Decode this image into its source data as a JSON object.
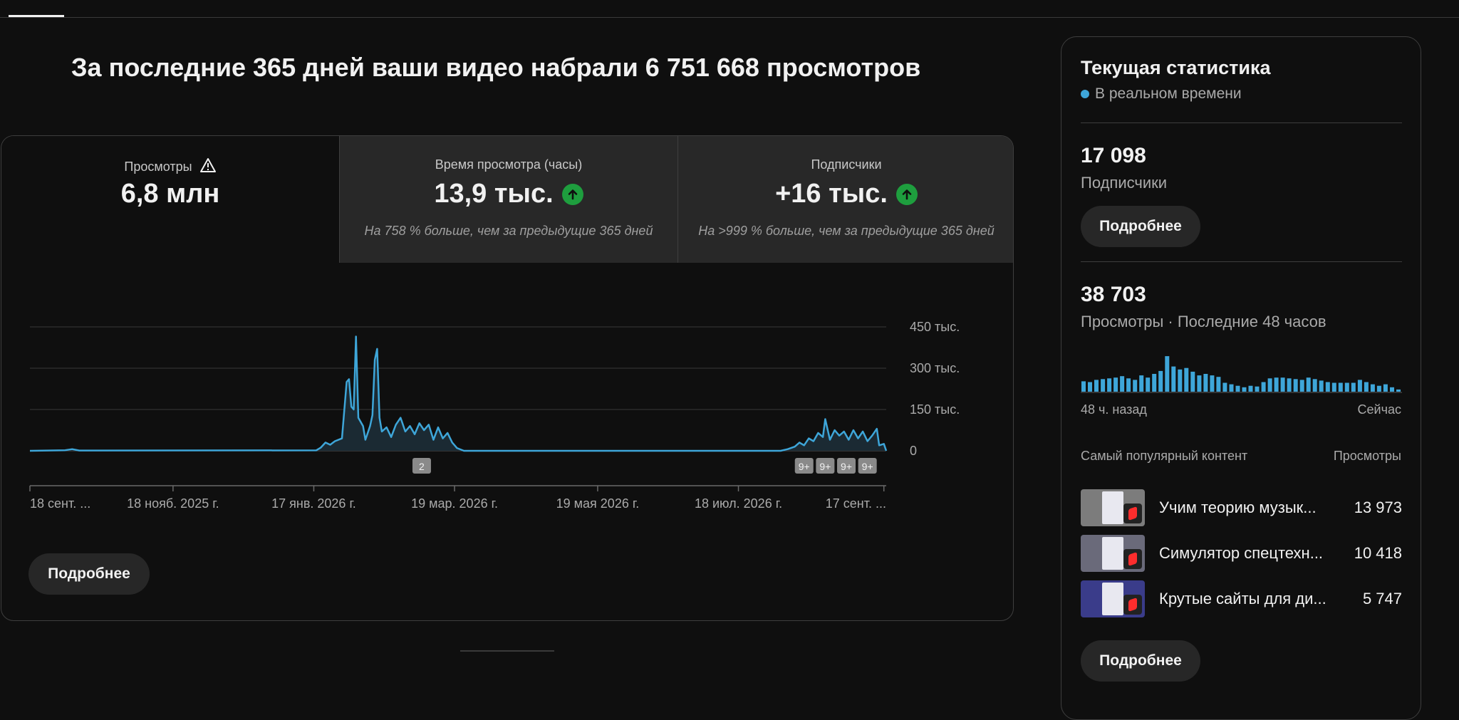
{
  "headline": "За последние 365 дней ваши видео набрали 6 751 668 просмотров",
  "metrics": [
    {
      "label": "Просмотры",
      "value": "6,8 млн",
      "icon": "warning-icon"
    },
    {
      "label": "Время просмотра (часы)",
      "value": "13,9 тыс.",
      "delta": "На 758 % больше, чем за предыдущие 365 дней",
      "icon": "arrow-up-icon"
    },
    {
      "label": "Подписчики",
      "value": "+16 тыс.",
      "delta": "На >999 % больше, чем за предыдущие 365 дней",
      "icon": "arrow-up-icon"
    }
  ],
  "main_more_label": "Подробнее",
  "chart_data": {
    "type": "line",
    "y_ticks": [
      "450 тыс.",
      "300 тыс.",
      "150 тыс.",
      "0"
    ],
    "x_ticks": [
      "18 сент. ...",
      "18 нояб. 2025 г.",
      "17 янв. 2026 г.",
      "19 мар. 2026 г.",
      "19 мая 2026 г.",
      "18 июл. 2026 г.",
      "17 сент. ..."
    ],
    "ylim": [
      0,
      450000
    ],
    "grid": true,
    "markers": [
      "2",
      "9+",
      "9+",
      "9+",
      "9+"
    ],
    "series": [
      {
        "values": [
          {
            "day": 0,
            "v": 0
          },
          {
            "day": 15,
            "v": 2000
          },
          {
            "day": 18,
            "v": 6000
          },
          {
            "day": 21,
            "v": 1000
          },
          {
            "day": 122,
            "v": 1500
          },
          {
            "day": 124,
            "v": 12000
          },
          {
            "day": 126,
            "v": 30000
          },
          {
            "day": 128,
            "v": 22000
          },
          {
            "day": 130,
            "v": 35000
          },
          {
            "day": 133,
            "v": 45000
          },
          {
            "day": 135,
            "v": 250000
          },
          {
            "day": 136,
            "v": 260000
          },
          {
            "day": 137,
            "v": 160000
          },
          {
            "day": 138,
            "v": 150000
          },
          {
            "day": 139,
            "v": 415000
          },
          {
            "day": 140,
            "v": 120000
          },
          {
            "day": 142,
            "v": 90000
          },
          {
            "day": 143,
            "v": 40000
          },
          {
            "day": 145,
            "v": 90000
          },
          {
            "day": 146,
            "v": 130000
          },
          {
            "day": 147,
            "v": 330000
          },
          {
            "day": 148,
            "v": 370000
          },
          {
            "day": 149,
            "v": 120000
          },
          {
            "day": 150,
            "v": 70000
          },
          {
            "day": 152,
            "v": 85000
          },
          {
            "day": 154,
            "v": 50000
          },
          {
            "day": 156,
            "v": 95000
          },
          {
            "day": 158,
            "v": 120000
          },
          {
            "day": 160,
            "v": 70000
          },
          {
            "day": 162,
            "v": 90000
          },
          {
            "day": 164,
            "v": 60000
          },
          {
            "day": 166,
            "v": 100000
          },
          {
            "day": 168,
            "v": 75000
          },
          {
            "day": 170,
            "v": 95000
          },
          {
            "day": 172,
            "v": 40000
          },
          {
            "day": 174,
            "v": 85000
          },
          {
            "day": 176,
            "v": 45000
          },
          {
            "day": 178,
            "v": 65000
          },
          {
            "day": 180,
            "v": 30000
          },
          {
            "day": 182,
            "v": 10000
          },
          {
            "day": 185,
            "v": 0
          },
          {
            "day": 320,
            "v": 0
          },
          {
            "day": 323,
            "v": 6000
          },
          {
            "day": 326,
            "v": 15000
          },
          {
            "day": 328,
            "v": 30000
          },
          {
            "day": 330,
            "v": 20000
          },
          {
            "day": 332,
            "v": 45000
          },
          {
            "day": 334,
            "v": 35000
          },
          {
            "day": 336,
            "v": 65000
          },
          {
            "day": 338,
            "v": 50000
          },
          {
            "day": 339,
            "v": 115000
          },
          {
            "day": 341,
            "v": 40000
          },
          {
            "day": 343,
            "v": 75000
          },
          {
            "day": 345,
            "v": 55000
          },
          {
            "day": 347,
            "v": 70000
          },
          {
            "day": 349,
            "v": 40000
          },
          {
            "day": 351,
            "v": 75000
          },
          {
            "day": 353,
            "v": 45000
          },
          {
            "day": 355,
            "v": 70000
          },
          {
            "day": 357,
            "v": 35000
          },
          {
            "day": 359,
            "v": 55000
          },
          {
            "day": 361,
            "v": 80000
          },
          {
            "day": 362,
            "v": 20000
          },
          {
            "day": 364,
            "v": 25000
          }
        ]
      }
    ]
  },
  "side": {
    "title": "Текущая статистика",
    "realtime_label": "В реальном времени",
    "subscribers": "17 098",
    "subscribers_label": "Подписчики",
    "more_label_1": "Подробнее",
    "views": "38 703",
    "views_label": "Просмотры · Последние 48 часов",
    "mini_chart_values": [
      14,
      13,
      16,
      17,
      18,
      19,
      21,
      18,
      16,
      22,
      19,
      24,
      28,
      48,
      34,
      30,
      32,
      27,
      22,
      24,
      22,
      20,
      12,
      10,
      8,
      6,
      8,
      7,
      13,
      18,
      19,
      19,
      18,
      17,
      16,
      19,
      17,
      15,
      13,
      12,
      12,
      12,
      12,
      16,
      13,
      10,
      8,
      10,
      6,
      3
    ],
    "axis_left": "48 ч. назад",
    "axis_right": "Сейчас",
    "top_content_label": "Самый популярный контент",
    "top_views_label": "Просмотры",
    "content": [
      {
        "title": "Учим теорию музык...",
        "views": "13 973",
        "thumb_color": "#7c7c7c"
      },
      {
        "title": "Симулятор спецтехн...",
        "views": "10 418",
        "thumb_color": "#6a6a7a"
      },
      {
        "title": "Крутые сайты для ди...",
        "views": "5 747",
        "thumb_color": "#3a3c8a"
      }
    ],
    "more_label_2": "Подробнее",
    "accent_color": "#3ea6d9"
  }
}
